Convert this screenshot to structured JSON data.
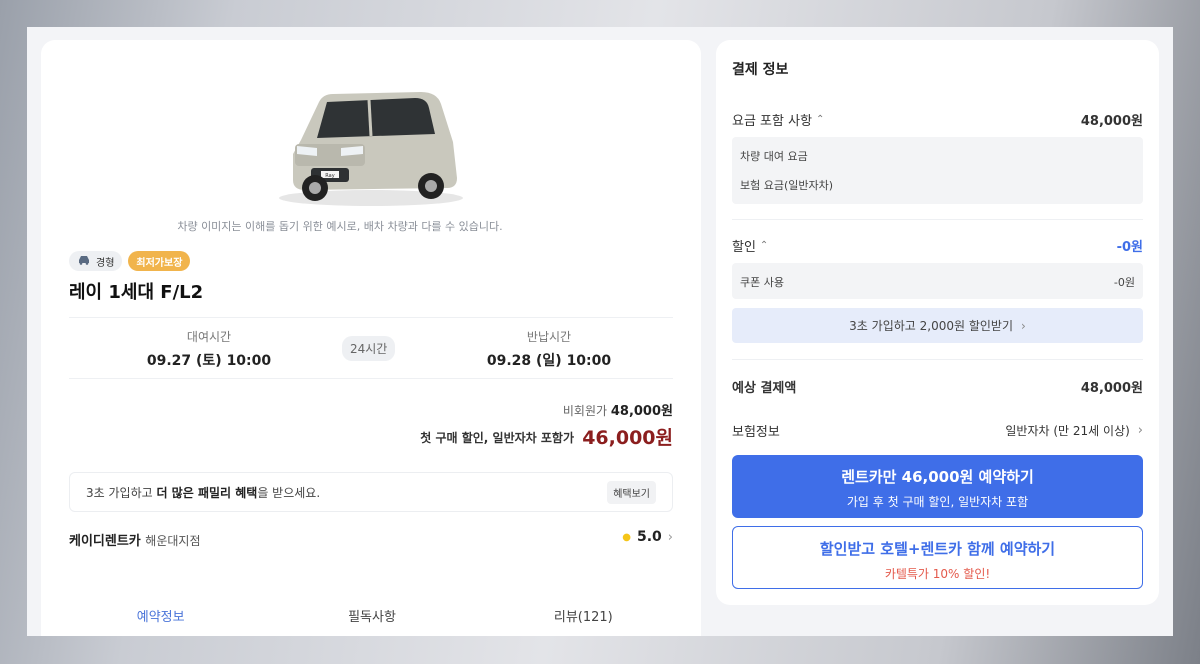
{
  "car": {
    "caption": "차량 이미지는 이해를 돕기 위한 예시로, 배차 차량과 다를 수 있습니다.",
    "type_tag": "경형",
    "price_tag": "최저가보장",
    "name": "레이 1세대 F/L2",
    "badge_text": "Ray"
  },
  "rental": {
    "pickup_label": "대여시간",
    "pickup_value": "09.27 (토) 10:00",
    "duration": "24시간",
    "return_label": "반납시간",
    "return_value": "09.28 (일) 10:00"
  },
  "price": {
    "nonmember_label": "비회원가",
    "nonmember_value": "48,000원",
    "first_purchase_label": "첫 구매 할인, 일반자차 포함가",
    "first_purchase_value": "46,000원"
  },
  "promo": {
    "text_a": "3초 가입하고 ",
    "text_b": "더 많은 패밀리 혜택",
    "text_c": "을 받으세요.",
    "button": "혜택보기"
  },
  "branch": {
    "company": "케이디렌트카",
    "location": "해운대지점",
    "rating": "5.0"
  },
  "tabs": [
    {
      "label": "예약정보",
      "active": true
    },
    {
      "label": "필독사항",
      "active": false
    },
    {
      "label": "리뷰(121)",
      "active": false
    }
  ],
  "payment": {
    "title": "결제 정보",
    "fee_label": "요금 포함 사항",
    "fee_value": "48,000원",
    "fee_items": [
      "차량 대여 요금",
      "보험 요금(일반자차)"
    ],
    "discount_label": "할인",
    "discount_value": "-0원",
    "coupon_label": "쿠폰 사용",
    "coupon_value": "-0원",
    "signup_button": "3초 가입하고 2,000원 할인받기",
    "expected_label": "예상 결제액",
    "expected_value": "48,000원",
    "insurance_label": "보험정보",
    "insurance_value": "일반자차 (만 21세 이상)",
    "main_button_title": "렌트카만 46,000원 예약하기",
    "main_button_sub": "가입 후 첫 구매 할인, 일반자차 포함",
    "hotel_button_title": "할인받고 호텔+렌트카 함께 예약하기",
    "hotel_button_sub": "카텔특가 10% 할인!"
  },
  "colors": {
    "accent": "#3f6ee8",
    "price_red": "#8b1e1e",
    "gold": "#f1b44c"
  }
}
